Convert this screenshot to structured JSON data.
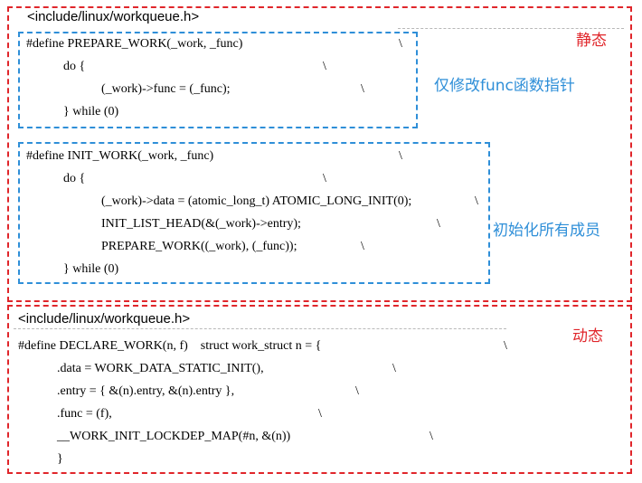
{
  "static_section": {
    "header": "<include/linux/workqueue.h>",
    "label": "静态",
    "prepare_work": {
      "lines": [
        "#define PREPARE_WORK(_work, _func)",
        "do {",
        "(_work)->func = (_func);",
        "} while (0)"
      ],
      "backslash": "\\",
      "note": "仅修改func函数指针"
    },
    "init_work": {
      "lines": [
        "#define INIT_WORK(_work, _func)",
        "do {",
        "(_work)->data = (atomic_long_t) ATOMIC_LONG_INIT(0);",
        "INIT_LIST_HEAD(&(_work)->entry);",
        "PREPARE_WORK((_work), (_func));",
        "} while (0)"
      ],
      "backslash": "\\",
      "note": "初始化所有成员"
    }
  },
  "dynamic_section": {
    "header": "<include/linux/workqueue.h>",
    "label": "动态",
    "lines": [
      "#define DECLARE_WORK(n, f)    struct work_struct n = {",
      ".data = WORK_DATA_STATIC_INIT(),",
      ".entry = { &(n).entry, &(n).entry },",
      ".func = (f),",
      "__WORK_INIT_LOCKDEP_MAP(#n, &(n))",
      "}"
    ],
    "backslash": "\\"
  }
}
